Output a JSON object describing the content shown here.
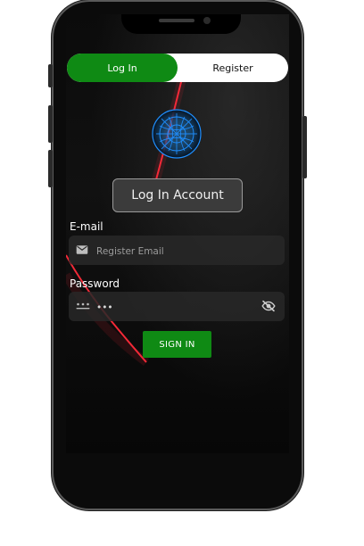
{
  "tabs": {
    "login_label": "Log In",
    "register_label": "Register"
  },
  "title": {
    "text": "Log In Account"
  },
  "email": {
    "label": "E-mail",
    "placeholder": "Register Email"
  },
  "password": {
    "label": "Password",
    "masked_value": "•••"
  },
  "actions": {
    "signin_label": "SIGN IN"
  },
  "colors": {
    "accent": "#0f8a14",
    "background": "#050505",
    "tab_inactive": "#ffffff"
  },
  "icons": {
    "email": "mail-icon",
    "password": "password-dots-icon",
    "visibility": "visibility-off-icon"
  }
}
